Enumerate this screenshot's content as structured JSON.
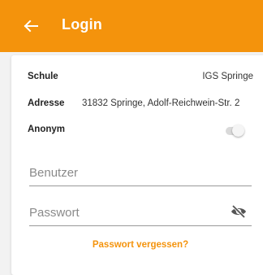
{
  "appbar": {
    "title": "Login",
    "back_icon": "arrow-left-icon",
    "color": "#f4930c"
  },
  "info": {
    "school_label": "Schule",
    "school_value": "IGS Springe",
    "address_label": "Adresse",
    "address_value": "31832 Springe, Adolf-Reichwein-Str. 2",
    "anonymous_label": "Anonym",
    "anonymous_on": false
  },
  "form": {
    "username_placeholder": "Benutzer",
    "username_value": "",
    "password_placeholder": "Passwort",
    "password_value": "",
    "password_icon": "eye-off-icon"
  },
  "links": {
    "forgot_password": "Passwort vergessen?"
  }
}
